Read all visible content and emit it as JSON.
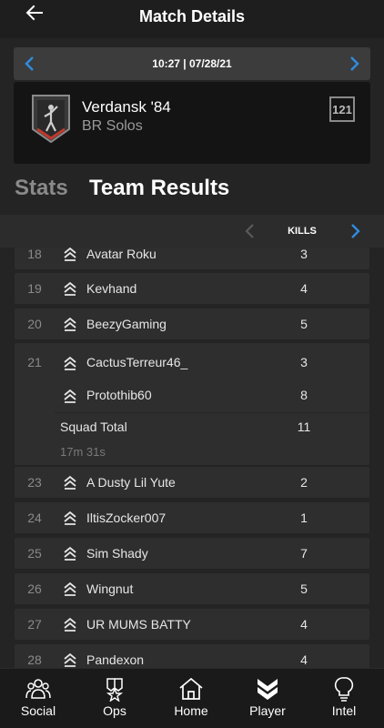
{
  "header": {
    "title": "Match Details"
  },
  "match": {
    "datetime": "10:27 | 07/28/21",
    "map": "Verdansk '84",
    "mode": "BR Solos",
    "badge": "121"
  },
  "tabs": [
    {
      "label": "Stats",
      "active": false
    },
    {
      "label": "Team Results",
      "active": true
    }
  ],
  "column": {
    "label": "KILLS"
  },
  "results": [
    {
      "rank": "18",
      "name": "Avatar Roku",
      "kills": "3"
    },
    {
      "rank": "19",
      "name": "Kevhand",
      "kills": "4"
    },
    {
      "rank": "20",
      "name": "BeezyGaming",
      "kills": "5"
    }
  ],
  "squad": {
    "rank": "21",
    "players": [
      {
        "name": "CactusTerreur46_",
        "kills": "3"
      },
      {
        "name": "Protothib60",
        "kills": "8"
      }
    ],
    "total_label": "Squad Total",
    "total_kills": "11",
    "time": "17m 31s"
  },
  "results_after": [
    {
      "rank": "23",
      "name": "A Dusty Lil Yute",
      "kills": "2"
    },
    {
      "rank": "24",
      "name": "IltisZocker007",
      "kills": "1"
    },
    {
      "rank": "25",
      "name": "Sim Shady",
      "kills": "7"
    },
    {
      "rank": "26",
      "name": "Wingnut",
      "kills": "5"
    },
    {
      "rank": "27",
      "name": "UR MUMS BATTY",
      "kills": "4"
    },
    {
      "rank": "28",
      "name": "Pandexon",
      "kills": "4"
    }
  ],
  "nav": [
    {
      "label": "Social",
      "icon": "social-icon"
    },
    {
      "label": "Ops",
      "icon": "ops-icon"
    },
    {
      "label": "Home",
      "icon": "home-icon"
    },
    {
      "label": "Player",
      "icon": "player-icon"
    },
    {
      "label": "Intel",
      "icon": "intel-icon"
    }
  ],
  "colors": {
    "accent": "#2f8ce0",
    "background": "#242424",
    "row": "#2e2e2e"
  }
}
